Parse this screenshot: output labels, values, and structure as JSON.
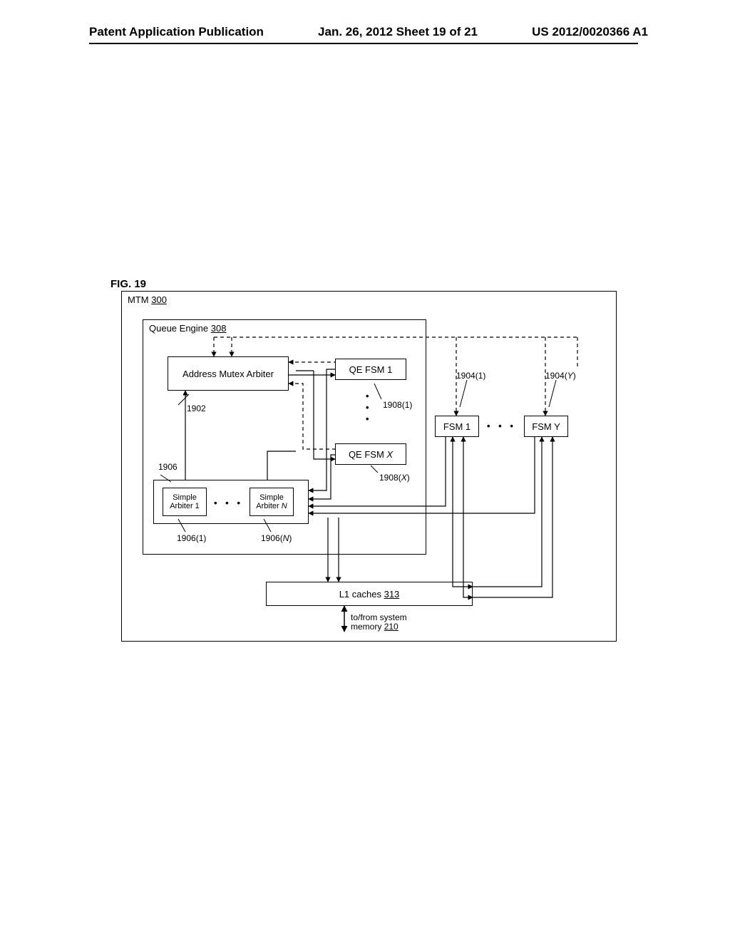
{
  "header": {
    "left": "Patent Application Publication",
    "center": "Jan. 26, 2012  Sheet 19 of 21",
    "right": "US 2012/0020366 A1"
  },
  "figure_label": "FIG. 19",
  "blocks": {
    "mtm": {
      "label": "MTM",
      "ref": "300"
    },
    "queue_engine": {
      "label": "Queue Engine",
      "ref": "308"
    },
    "addr_mutex": {
      "label": "Address Mutex Arbiter"
    },
    "qe_fsm_1": {
      "label": "QE FSM 1"
    },
    "qe_fsm_x": {
      "label": "QE FSM X",
      "italic_var": "X"
    },
    "simple_arbiter_1": {
      "label1": "Simple",
      "label2": "Arbiter 1"
    },
    "simple_arbiter_n": {
      "label1": "Simple",
      "label2": "Arbiter N",
      "italic_var": "N"
    },
    "fsm_1": {
      "label": "FSM 1"
    },
    "fsm_y": {
      "label": "FSM Y"
    },
    "l1_caches": {
      "label": "L1 caches",
      "ref": "313"
    },
    "memory_text1": "to/from system",
    "memory_text2": "memory",
    "memory_ref": "210"
  },
  "refs": {
    "r1902": "1902",
    "r1906": "1906",
    "r1906_1": "1906(1)",
    "r1906_N": "1906(N)",
    "r1908_1": "1908(1)",
    "r1908_X": "1908(X)",
    "r1904_1": "1904(1)",
    "r1904_Y": "1904(Y)"
  },
  "chart_data": {
    "type": "table",
    "description": "Block diagram of MTM 300 containing Queue Engine 308 with Address Mutex Arbiter, multiple QE FSMs, Simple Arbiters, external FSMs, and L1 caches connected to system memory.",
    "blocks": [
      {
        "id": "MTM",
        "ref": "300",
        "contains": [
          "QueueEngine",
          "FSM_1..Y",
          "L1_caches"
        ]
      },
      {
        "id": "QueueEngine",
        "ref": "308",
        "contains": [
          "AddressMutexArbiter",
          "QE_FSM_1..X",
          "SimpleArbiterGroup"
        ]
      },
      {
        "id": "AddressMutexArbiter",
        "ref": "1902"
      },
      {
        "id": "QE_FSM_1",
        "ref": "1908(1)"
      },
      {
        "id": "QE_FSM_X",
        "ref": "1908(X)"
      },
      {
        "id": "SimpleArbiterGroup",
        "ref": "1906",
        "contains": [
          "SimpleArbiter_1",
          "SimpleArbiter_N"
        ]
      },
      {
        "id": "SimpleArbiter_1",
        "ref": "1906(1)"
      },
      {
        "id": "SimpleArbiter_N",
        "ref": "1906(N)"
      },
      {
        "id": "FSM_1",
        "ref": "1904(1)"
      },
      {
        "id": "FSM_Y",
        "ref": "1904(Y)"
      },
      {
        "id": "L1_caches",
        "ref": "313"
      },
      {
        "id": "SystemMemory",
        "ref": "210"
      }
    ],
    "connections": [
      {
        "from": "AddressMutexArbiter",
        "to": "QE_FSM_1",
        "style": "dashed",
        "dir": "both"
      },
      {
        "from": "AddressMutexArbiter",
        "to": "QE_FSM_X",
        "style": "dashed",
        "dir": "both"
      },
      {
        "from": "QE_FSM_1",
        "to": "SimpleArbiterGroup",
        "style": "solid",
        "dir": "to"
      },
      {
        "from": "QE_FSM_X",
        "to": "SimpleArbiterGroup",
        "style": "solid",
        "dir": "to"
      },
      {
        "from": "SimpleArbiterGroup",
        "to": "L1_caches",
        "style": "solid",
        "dir": "to"
      },
      {
        "from": "FSM_1",
        "to": "SimpleArbiterGroup",
        "style": "solid",
        "dir": "to"
      },
      {
        "from": "FSM_Y",
        "to": "SimpleArbiterGroup",
        "style": "solid",
        "dir": "to"
      },
      {
        "from": "FSM_1",
        "to": "L1_caches",
        "style": "solid",
        "dir": "both"
      },
      {
        "from": "FSM_Y",
        "to": "L1_caches",
        "style": "solid",
        "dir": "both"
      },
      {
        "from": "external_top",
        "to": "AddressMutexArbiter",
        "style": "dashed",
        "dir": "to"
      },
      {
        "from": "external_top",
        "to": "FSM_1",
        "style": "dashed",
        "dir": "to"
      },
      {
        "from": "external_top",
        "to": "FSM_Y",
        "style": "dashed",
        "dir": "to"
      },
      {
        "from": "L1_caches",
        "to": "SystemMemory",
        "style": "solid",
        "dir": "both"
      }
    ]
  }
}
